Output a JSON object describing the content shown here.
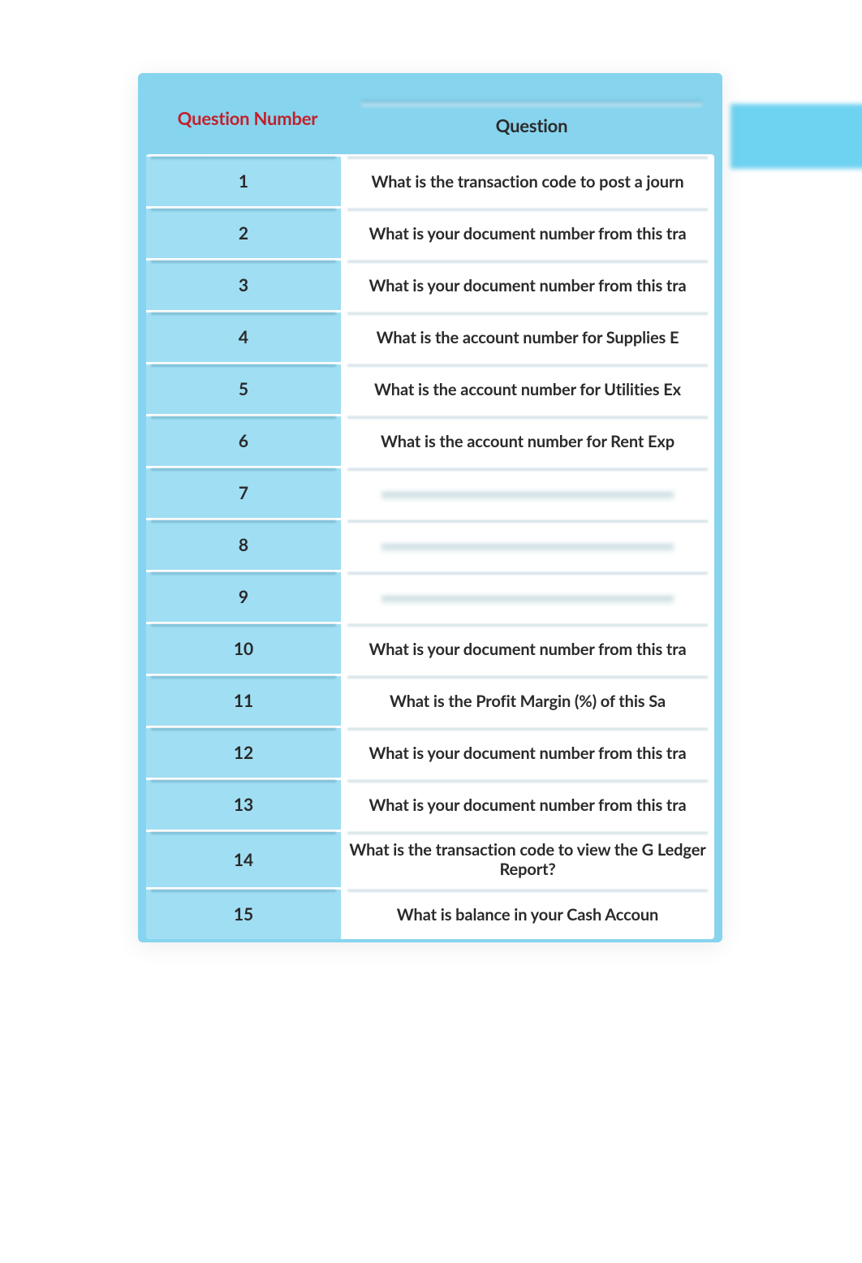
{
  "table": {
    "headers": {
      "number": "Question Number",
      "question": "Question"
    },
    "rows": [
      {
        "n": "1",
        "q": "What is the transaction code to post a journ"
      },
      {
        "n": "2",
        "q": "What is your document number from this tra"
      },
      {
        "n": "3",
        "q": "What is your document number from this tra"
      },
      {
        "n": "4",
        "q": "What is the account number for Supplies E"
      },
      {
        "n": "5",
        "q": "What is the account number for Utilities Ex"
      },
      {
        "n": "6",
        "q": "What is the account number for Rent Exp"
      },
      {
        "n": "7",
        "q": ""
      },
      {
        "n": "8",
        "q": ""
      },
      {
        "n": "9",
        "q": ""
      },
      {
        "n": "10",
        "q": "What is your document number from this tra"
      },
      {
        "n": "11",
        "q": "What is the Profit Margin (%) of this Sa"
      },
      {
        "n": "12",
        "q": "What is your document number from this tra"
      },
      {
        "n": "13",
        "q": "What is your document number from this tra"
      },
      {
        "n": "14",
        "q": "What is the transaction code to view the G Ledger Report?"
      },
      {
        "n": "15",
        "q": "What is balance in your Cash Accoun"
      }
    ]
  }
}
